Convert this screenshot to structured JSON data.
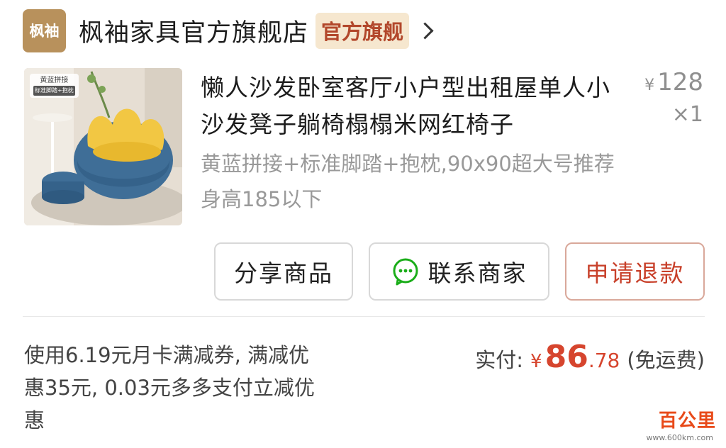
{
  "shop": {
    "logo_text": "枫袖",
    "name": "枫袖家具官方旗舰店",
    "badge": "官方旗舰"
  },
  "product": {
    "image_tag": "黄蓝拼接",
    "image_tag_sub": "标准脚踏+抱枕",
    "title": "懒人沙发卧室客厅小户型出租屋单人小沙发凳子躺椅榻榻米网红椅子",
    "spec": "黄蓝拼接+标准脚踏+抱枕,90x90超大号推荐身高185以下",
    "price_symbol": "¥",
    "price": "128",
    "quantity": "×1"
  },
  "actions": {
    "share": "分享商品",
    "contact": "联系商家",
    "refund": "申请退款"
  },
  "summary": {
    "promo": "使用6.19元月卡满减券, 满减优惠35元, 0.03元多多支付立减优惠",
    "paid_label": "实付:",
    "paid_symbol": "¥",
    "paid_integer": "86",
    "paid_decimal": ".78",
    "shipping": "(免运费)"
  },
  "watermark": {
    "main": "百公里",
    "url": "www.600km.com"
  },
  "colors": {
    "accent_red": "#d6452e",
    "logo_bg": "#b8915c",
    "badge_bg": "#f6e7cf",
    "wechat_green": "#1aad19"
  }
}
